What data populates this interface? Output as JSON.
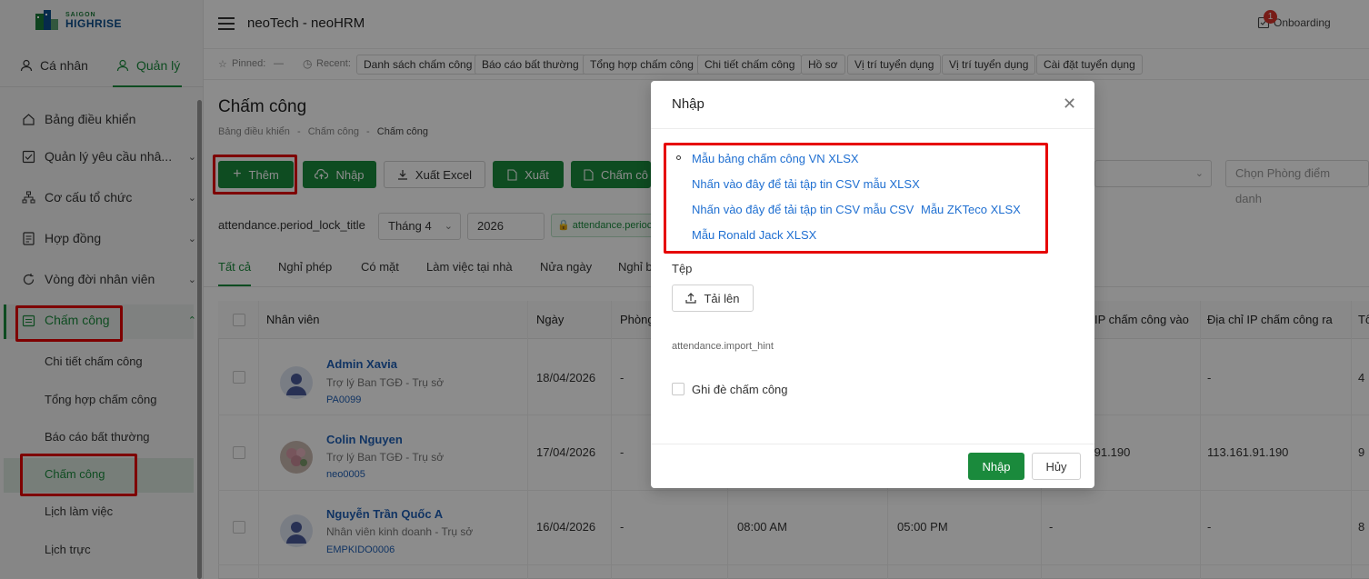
{
  "logo": {
    "line1": "SAIGON",
    "line2": "HIGHRISE"
  },
  "sidebar": {
    "tabs": [
      {
        "label": "Cá nhân"
      },
      {
        "label": "Quản lý"
      }
    ],
    "menu": [
      {
        "label": "Bảng điều khiển"
      },
      {
        "label": "Quản lý yêu cầu nhâ..."
      },
      {
        "label": "Cơ cấu tổ chức"
      },
      {
        "label": "Hợp đồng"
      },
      {
        "label": "Vòng đời nhân viên"
      },
      {
        "label": "Chấm công"
      }
    ],
    "submenu": [
      {
        "label": "Chi tiết chấm công"
      },
      {
        "label": "Tổng hợp chấm công"
      },
      {
        "label": "Báo cáo bất thường"
      },
      {
        "label": "Chấm công"
      },
      {
        "label": "Lịch làm việc"
      },
      {
        "label": "Lịch trực"
      }
    ]
  },
  "header": {
    "title": "neoTech - neoHRM",
    "onboarding": "Onboarding",
    "notif_count": "1"
  },
  "recent": {
    "pinned_label": "Pinned:",
    "pinned_value": "—",
    "recent_label": "Recent:",
    "chips": [
      "Danh sách chấm công",
      "Báo cáo bất thường",
      "Tổng hợp chấm công",
      "Chi tiết chấm công",
      "Hồ sơ",
      "Vị trí tuyển dụng",
      "Vị trí tuyển dụng",
      "Cài đặt tuyển dụng"
    ]
  },
  "page": {
    "title": "Chấm công",
    "breadcrumb": [
      "Bảng điều khiển",
      "Chấm công",
      "Chấm công"
    ],
    "sep": "-"
  },
  "toolbar": {
    "add": "Thêm",
    "import": "Nhập",
    "export_excel": "Xuất Excel",
    "export": "Xuất",
    "attendance": "Chấm cô"
  },
  "filters": {
    "period_label": "attendance.period_lock_title",
    "month": "Tháng 4",
    "year": "2026",
    "lock_tag": "attendance.perioc",
    "room_placeholder": "Chọn Phòng điểm danh"
  },
  "tabs": [
    "Tất cả",
    "Nghỉ phép",
    "Có mặt",
    "Làm việc tại nhà",
    "Nửa ngày",
    "Nghỉ b"
  ],
  "table": {
    "headers": [
      "Nhân viên",
      "Ngày",
      "Phòng",
      "IP chấm công vào",
      "Địa chỉ IP chấm công ra",
      "Tổ"
    ],
    "rows": [
      {
        "name": "Admin Xavia",
        "position": "Trợ lý Ban TGĐ - Trụ sở",
        "code": "PA0099",
        "date": "18/04/2026",
        "room": "-",
        "check_in": "",
        "check_out": "",
        "ip_in": "",
        "ip_out": "-",
        "total": "4"
      },
      {
        "name": "Colin Nguyen",
        "position": "Trợ lý Ban TGĐ - Trụ sở",
        "code": "neo0005",
        "date": "17/04/2026",
        "room": "-",
        "check_in": "",
        "check_out": "",
        "ip_in": ".91.190",
        "ip_out": "113.161.91.190",
        "total": "9"
      },
      {
        "name": "Nguyễn Trần Quốc A",
        "position": "Nhân viên kinh doanh - Trụ sở",
        "code": "EMPKIDO0006",
        "date": "16/04/2026",
        "room": "-",
        "check_in": "08:00 AM",
        "check_out": "05:00 PM",
        "ip_in": "-",
        "ip_out": "-",
        "total": "8"
      }
    ]
  },
  "modal": {
    "title": "Nhập",
    "links": [
      "Mẫu bảng chấm công VN XLSX",
      "Nhấn vào đây để tải tập tin CSV mẫu XLSX",
      "Nhấn vào đây để tải tập tin CSV mẫu CSV",
      "Mẫu ZKTeco XLSX",
      "Mẫu Ronald Jack XLSX"
    ],
    "file_label": "Tệp",
    "upload": "Tải lên",
    "hint": "attendance.import_hint",
    "overwrite": "Ghi đè chấm công",
    "submit": "Nhập",
    "cancel": "Hủy"
  },
  "colors": {
    "primary": "#1a8a3c",
    "link": "#1f6fd1",
    "highlight": "#e60000"
  }
}
